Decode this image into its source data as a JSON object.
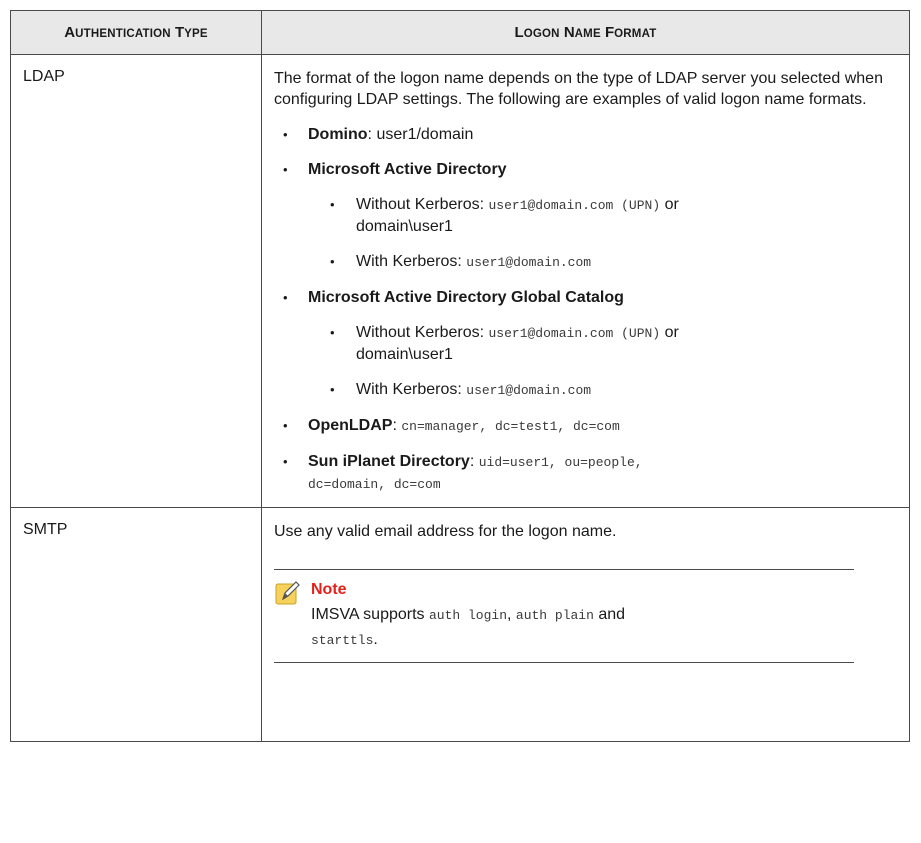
{
  "table": {
    "headers": {
      "col1": {
        "first_big": "A",
        "first_rest": "UTHENTICATION",
        "second_big": "T",
        "second_rest": "YPE"
      },
      "col2": {
        "first_big": "L",
        "first_rest": "OGON",
        "second_big": "N",
        "second_rest": "AME",
        "third_big": "F",
        "third_rest": "ORMAT"
      }
    },
    "ldap": {
      "type": "LDAP",
      "intro": "The format of the logon name depends on the type of LDAP server you selected when configuring LDAP settings. The following are examples of valid logon name formats.",
      "bullet": "•",
      "domino": {
        "name": "Domino",
        "sep": ": ",
        "value": "user1/domain"
      },
      "msad": {
        "name": "Microsoft Active Directory",
        "without": {
          "label": "Without Kerberos: ",
          "code": "user1@domain.com (UPN)",
          "or": " or",
          "rest": "domain\\user1"
        },
        "with": {
          "label": "With Kerberos: ",
          "code": "user1@domain.com"
        }
      },
      "msad_gc": {
        "name": "Microsoft Active Directory Global Catalog",
        "without": {
          "label": "Without Kerberos: ",
          "code": "user1@domain.com (UPN)",
          "or": " or",
          "rest": "domain\\user1"
        },
        "with": {
          "label": "With Kerberos: ",
          "code": "user1@domain.com"
        }
      },
      "openldap": {
        "name": "OpenLDAP",
        "sep": ": ",
        "code": "cn=manager, dc=test1, dc=com"
      },
      "iplanet": {
        "name": "Sun iPlanet Directory",
        "sep": ": ",
        "code1": "uid=user1, ou=people,",
        "code2": "dc=domain, dc=com"
      }
    },
    "smtp": {
      "type": "SMTP",
      "text": "Use any valid email address for the logon name.",
      "note": {
        "title": "Note",
        "pre": "IMSVA supports ",
        "code1": "auth login",
        "mid1": ", ",
        "code2": "auth plain",
        "and": " and",
        "code3": "starttls",
        "end": "."
      }
    }
  }
}
